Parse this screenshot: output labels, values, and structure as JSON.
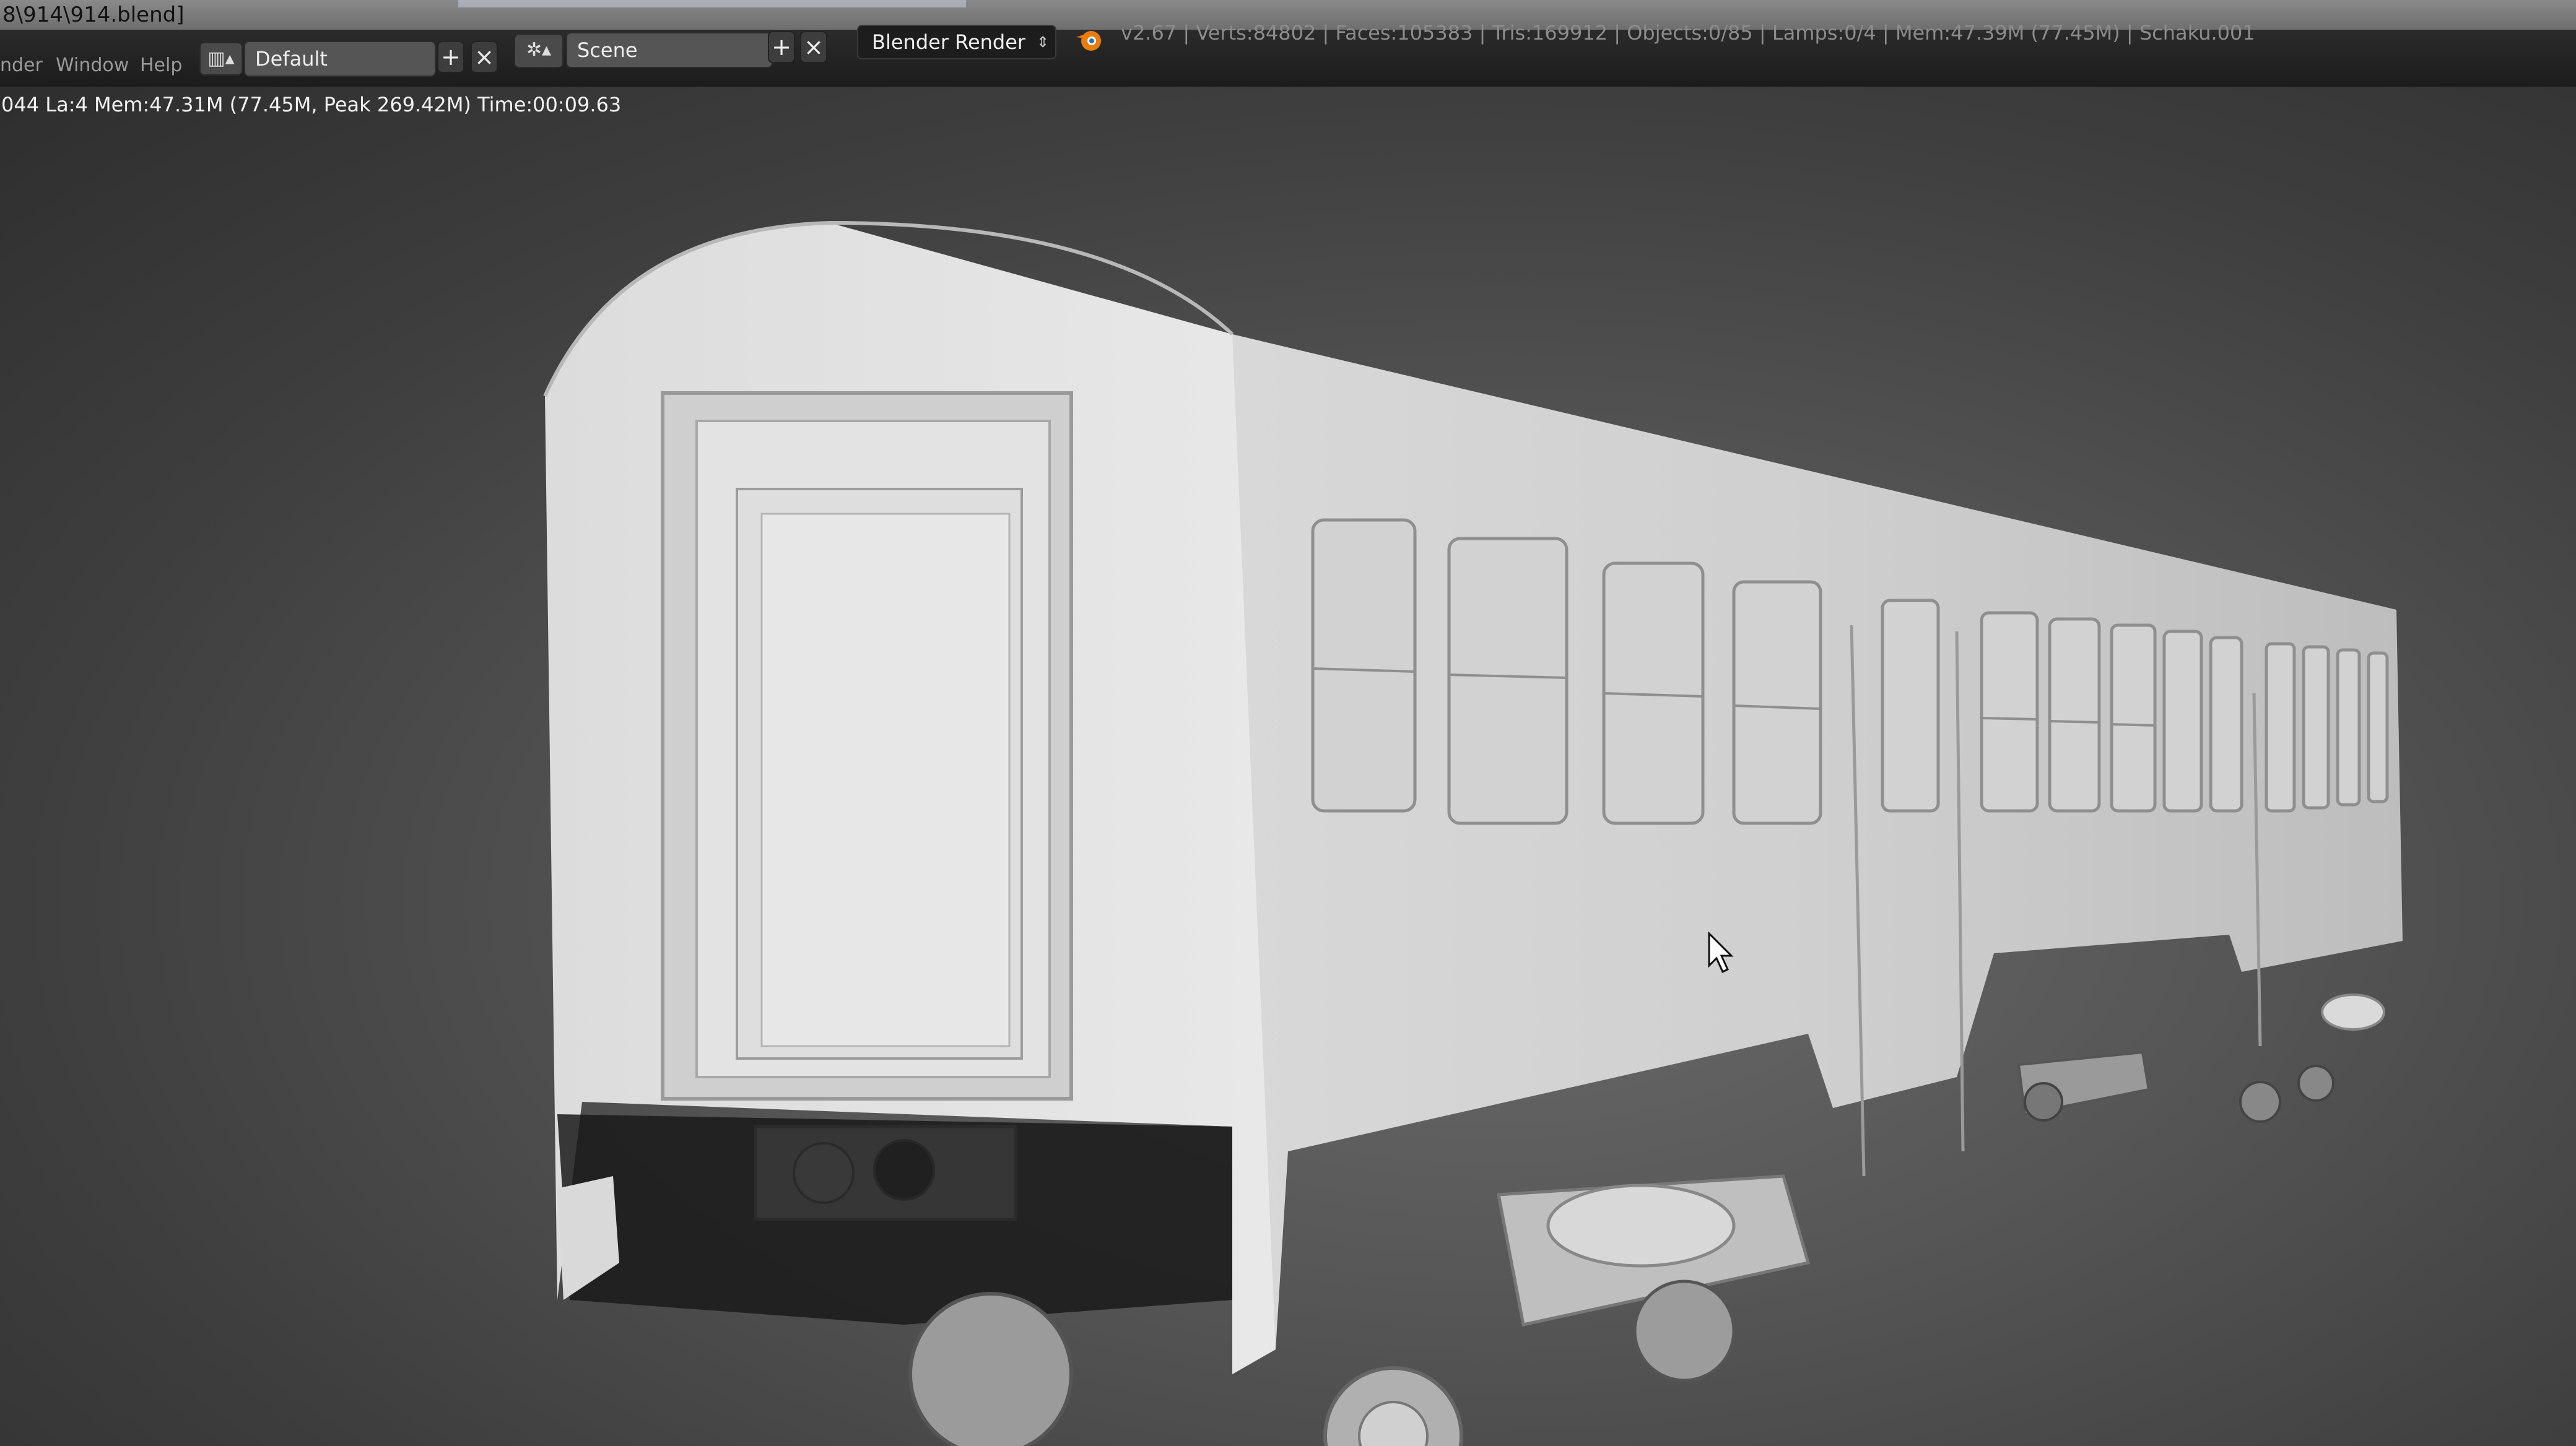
{
  "window": {
    "title": "8\\914\\914.blend]"
  },
  "menu": {
    "items": [
      "nder",
      "Window",
      "Help"
    ]
  },
  "screen_layout": {
    "value": "Default"
  },
  "scene": {
    "value": "Scene"
  },
  "render_engine": {
    "value": "Blender Render"
  },
  "stats": {
    "text": "v2.67 | Verts:84802 | Faces:105383 | Tris:169912 | Objects:0/85 | Lamps:0/4 | Mem:47.39M (77.45M) | Schaku.001"
  },
  "render_info": {
    "text": "044 La:4 Mem:47.31M (77.45M, Peak 269.42M) Time:00:09.63"
  },
  "icons": {
    "layout": "screen-layout-icon",
    "add": "add-icon",
    "remove": "close-icon",
    "scene": "scene-icon",
    "render": "blender-logo-icon",
    "cursor": "mouse-cursor-icon"
  },
  "colors": {
    "header_bg": "#1e1e1e",
    "viewport_bg": "#555555",
    "model": "#e6e6e6"
  }
}
